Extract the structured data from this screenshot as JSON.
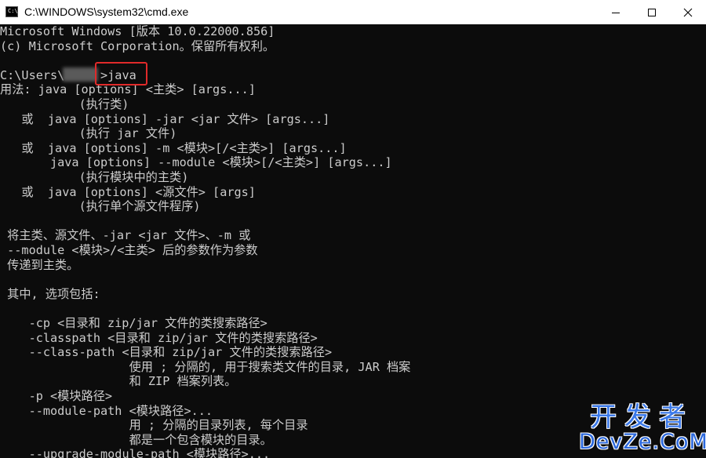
{
  "window": {
    "title": "C:\\WINDOWS\\system32\\cmd.exe",
    "icon_label": "C:\\",
    "icon_name": "cmd-icon"
  },
  "console": {
    "lines": [
      "Microsoft Windows [版本 10.0.22000.856]",
      "(c) Microsoft Corporation。保留所有权利。",
      "",
      "C:\\Users\\     >java",
      "用法: java [options] <主类> [args...]",
      "           (执行类)",
      "   或  java [options] -jar <jar 文件> [args...]",
      "           (执行 jar 文件)",
      "   或  java [options] -m <模块>[/<主类>] [args...]",
      "       java [options] --module <模块>[/<主类>] [args...]",
      "           (执行模块中的主类)",
      "   或  java [options] <源文件> [args]",
      "           (执行单个源文件程序)",
      "",
      " 将主类、源文件、-jar <jar 文件>、-m 或",
      " --module <模块>/<主类> 后的参数作为参数",
      " 传递到主类。",
      "",
      " 其中, 选项包括:",
      "",
      "    -cp <目录和 zip/jar 文件的类搜索路径>",
      "    -classpath <目录和 zip/jar 文件的类搜索路径>",
      "    --class-path <目录和 zip/jar 文件的类搜索路径>",
      "                  使用 ; 分隔的, 用于搜索类文件的目录, JAR 档案",
      "                  和 ZIP 档案列表。",
      "    -p <模块路径>",
      "    --module-path <模块路径>...",
      "                  用 ; 分隔的目录列表, 每个目录",
      "                  都是一个包含模块的目录。",
      "    --upgrade-module-path <模块路径>..."
    ]
  },
  "watermark": {
    "cn": "开发者",
    "en": "DevZe.CoM"
  },
  "colors": {
    "console_bg": "#0c0c0c",
    "console_fg": "#cccccc",
    "highlight": "#e02a2a",
    "watermark": "#2b68dd"
  }
}
